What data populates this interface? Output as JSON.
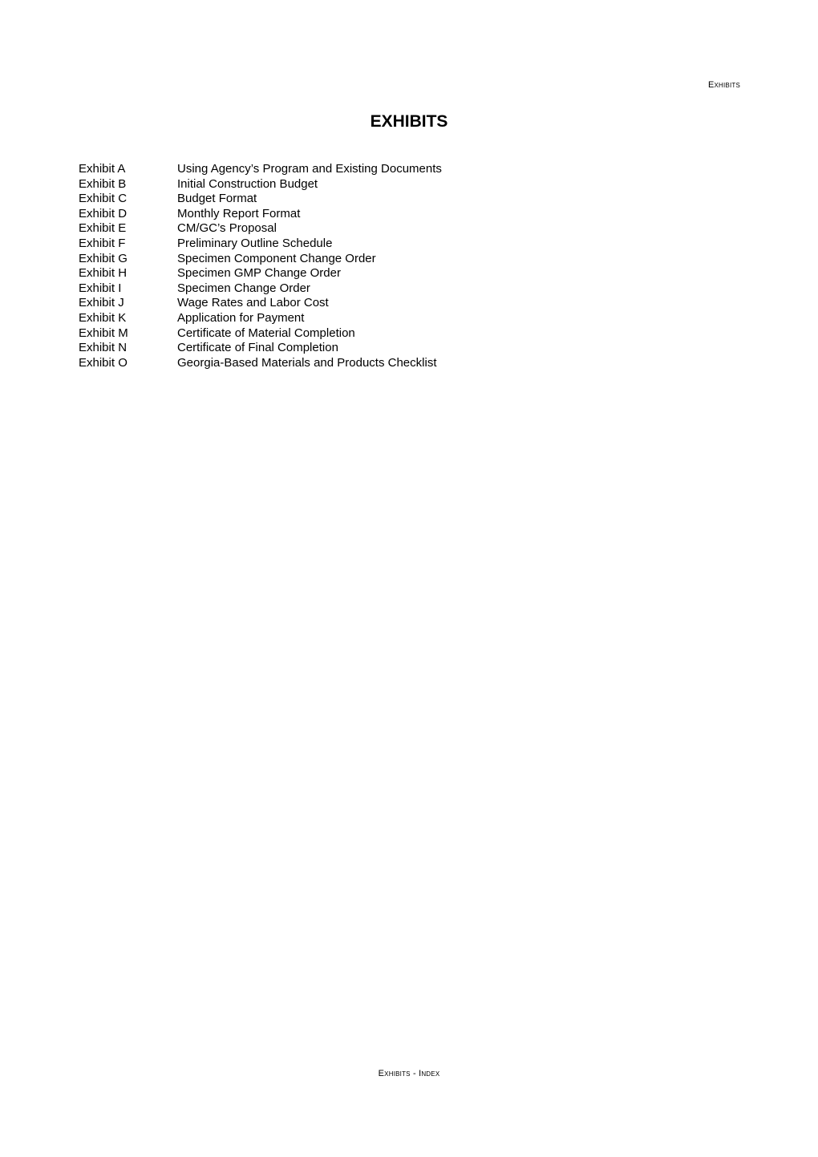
{
  "header": {
    "running_title": "Exhibits"
  },
  "title": "EXHIBITS",
  "exhibits": [
    {
      "label": "Exhibit A",
      "description": "Using Agency’s Program and Existing Documents"
    },
    {
      "label": "Exhibit B",
      "description": "Initial Construction Budget"
    },
    {
      "label": "Exhibit C",
      "description": "Budget Format"
    },
    {
      "label": "Exhibit D",
      "description": "Monthly Report Format"
    },
    {
      "label": "Exhibit E",
      "description": "CM/GC’s Proposal"
    },
    {
      "label": "Exhibit F",
      "description": "Preliminary Outline Schedule"
    },
    {
      "label": "Exhibit G",
      "description": "Specimen Component Change Order"
    },
    {
      "label": "Exhibit H",
      "description": "Specimen GMP Change Order"
    },
    {
      "label": "Exhibit I",
      "description": "Specimen Change Order"
    },
    {
      "label": "Exhibit J",
      "description": "Wage Rates and Labor Cost"
    },
    {
      "label": "Exhibit K",
      "description": "Application for Payment"
    },
    {
      "label": "Exhibit M",
      "description": "Certificate of Material Completion"
    },
    {
      "label": "Exhibit N",
      "description": "Certificate of Final Completion"
    },
    {
      "label": "Exhibit O",
      "description": "Georgia-Based Materials and Products Checklist"
    }
  ],
  "footer": {
    "text": "Exhibits - Index"
  }
}
